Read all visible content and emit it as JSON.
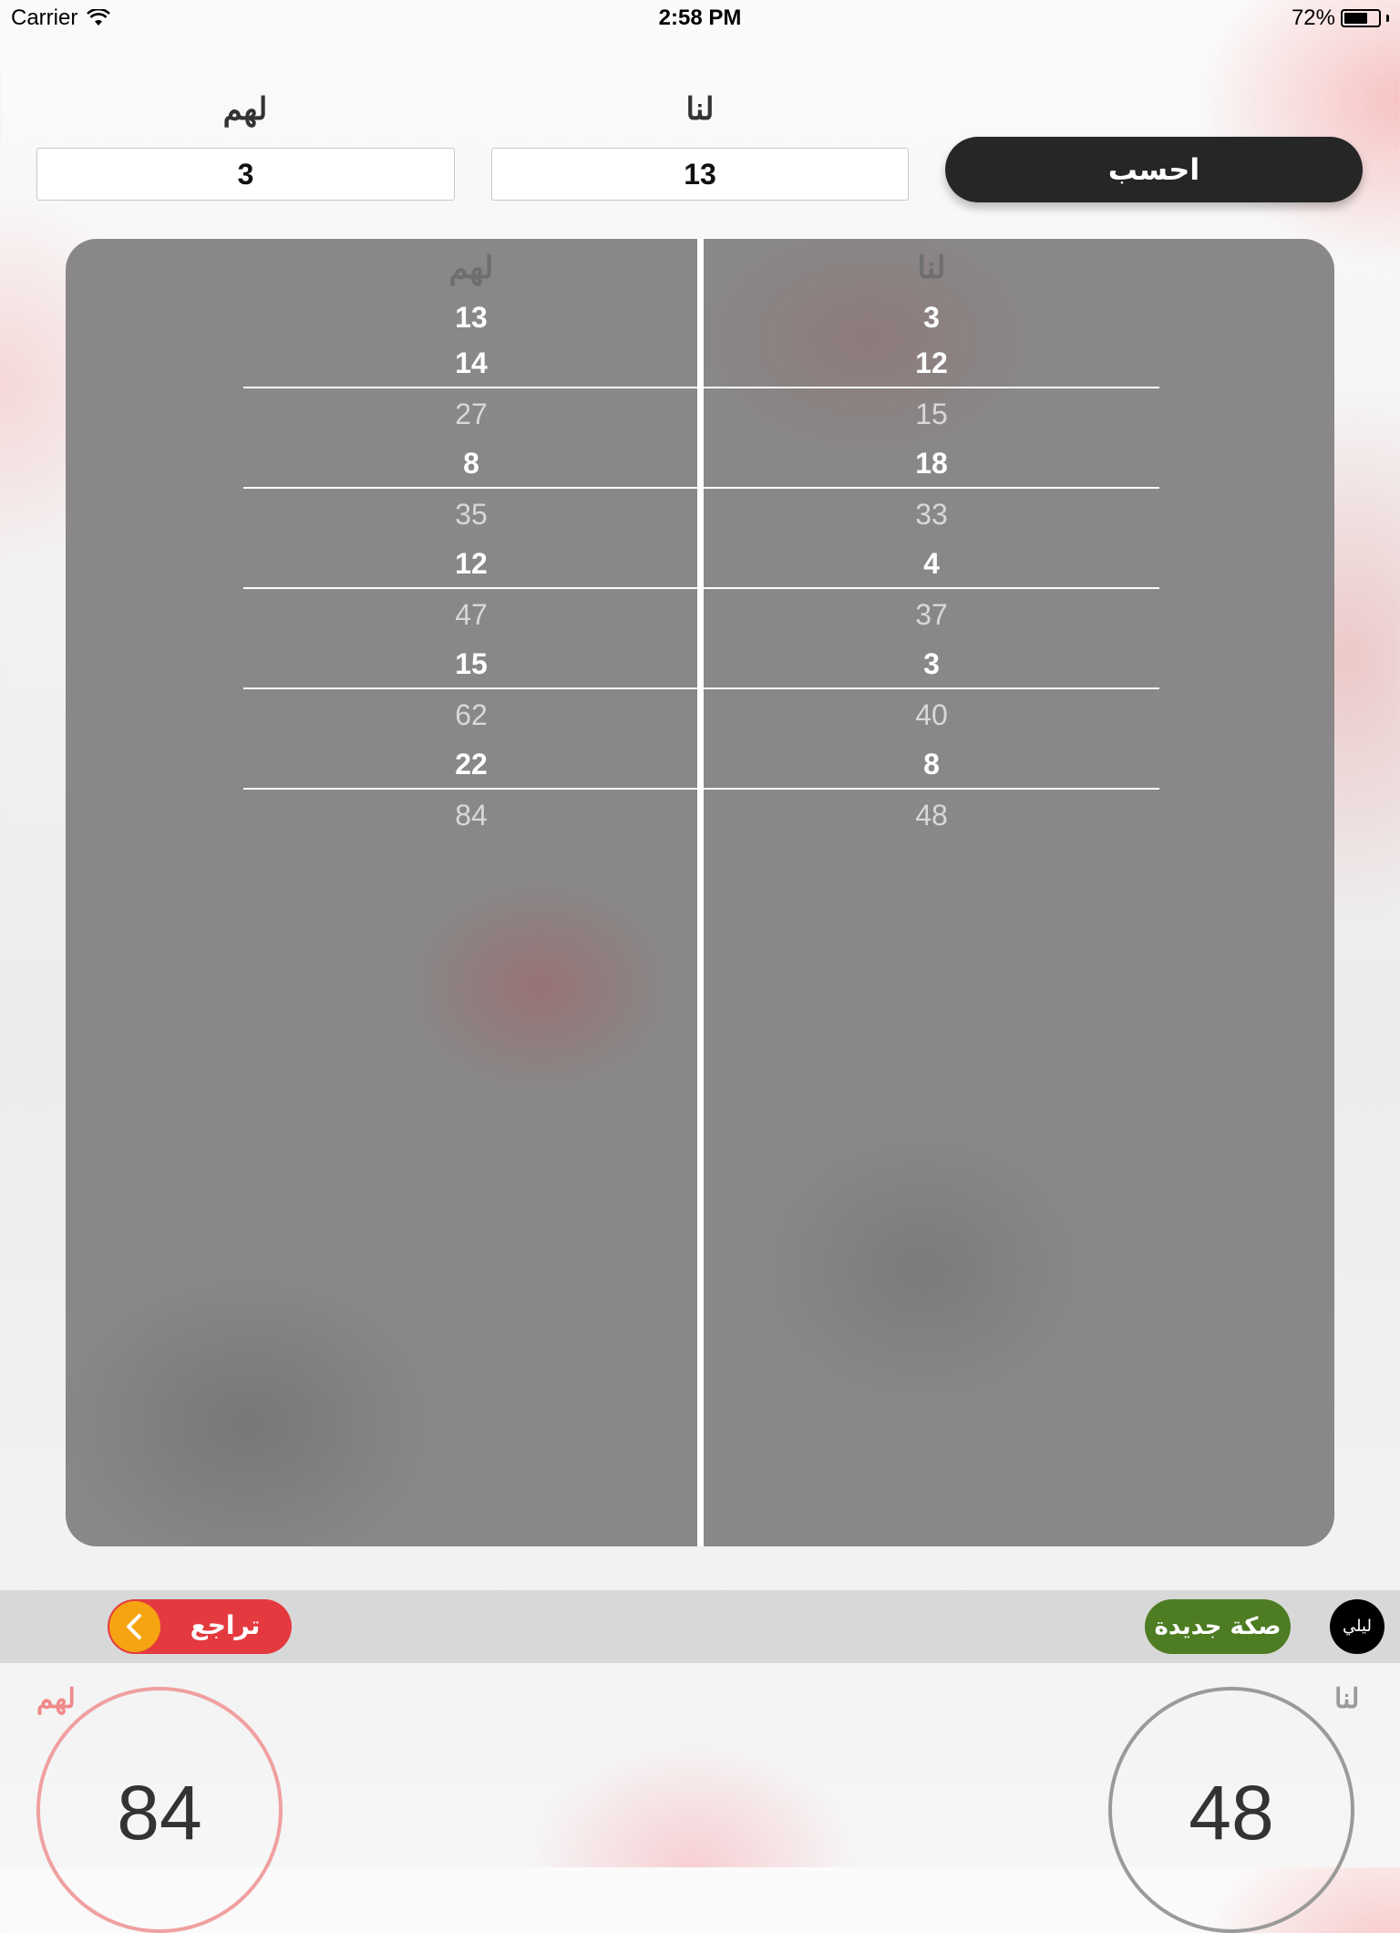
{
  "status_bar": {
    "carrier": "Carrier",
    "time": "2:58 PM",
    "battery_percent": "72%",
    "battery_level": 0.72
  },
  "input": {
    "them_label": "لهم",
    "us_label": "لنا",
    "them_value": "3",
    "us_value": "13",
    "calculate_label": "احسب"
  },
  "scoresheet": {
    "them_header": "لهم",
    "us_header": "لنا",
    "them": {
      "rounds": [
        {
          "added": [
            "13",
            "14"
          ],
          "total": "27"
        },
        {
          "added": [
            "8"
          ],
          "total": "35"
        },
        {
          "added": [
            "12"
          ],
          "total": "47"
        },
        {
          "added": [
            "15"
          ],
          "total": "62"
        },
        {
          "added": [
            "22"
          ],
          "total": "84"
        }
      ]
    },
    "us": {
      "rounds": [
        {
          "added": [
            "3",
            "12"
          ],
          "total": "15"
        },
        {
          "added": [
            "18"
          ],
          "total": "33"
        },
        {
          "added": [
            "4"
          ],
          "total": "37"
        },
        {
          "added": [
            "3"
          ],
          "total": "40"
        },
        {
          "added": [
            "8"
          ],
          "total": "48"
        }
      ]
    }
  },
  "toolbar": {
    "undo_label": "تراجع",
    "new_game_label": "صكة جديدة",
    "night_label": "ليلي"
  },
  "totals": {
    "them_label": "لهم",
    "them_score": "84",
    "us_label": "لنا",
    "us_score": "48"
  },
  "colors": {
    "accent_dark": "#262626",
    "undo_red": "#e43a3f",
    "undo_icon_orange": "#f6a412",
    "new_game_green": "#4e7c22",
    "them_circle": "#f0a0a0",
    "us_circle": "#9a9a9a",
    "panel_gray": "#898787"
  },
  "icons": {
    "wifi": "wifi-icon",
    "battery": "battery-icon",
    "undo": "chevron-left-icon"
  }
}
